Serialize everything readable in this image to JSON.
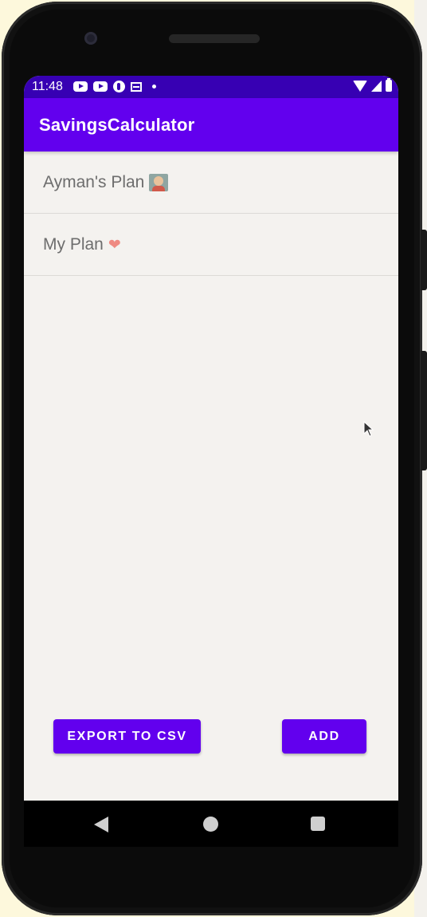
{
  "status_bar": {
    "time": "11:48",
    "left_icons": [
      "youtube-icon",
      "youtube-icon",
      "app-notification-icon",
      "news-icon",
      "dot-icon"
    ],
    "right_icons": [
      "wifi-icon",
      "signal-icon",
      "battery-icon"
    ]
  },
  "app_bar": {
    "title": "SavingsCalculator",
    "color": "#6200ee",
    "status_color": "#3700b3"
  },
  "plans": [
    {
      "label": "Ayman's Plan",
      "emoji": "teacher-emoji"
    },
    {
      "label": "My Plan",
      "emoji": "red-heart-emoji"
    }
  ],
  "buttons": {
    "export_label": "EXPORT TO CSV",
    "add_label": "ADD"
  },
  "nav_bar": {
    "icons": [
      "back-icon",
      "home-icon",
      "recents-icon"
    ]
  }
}
